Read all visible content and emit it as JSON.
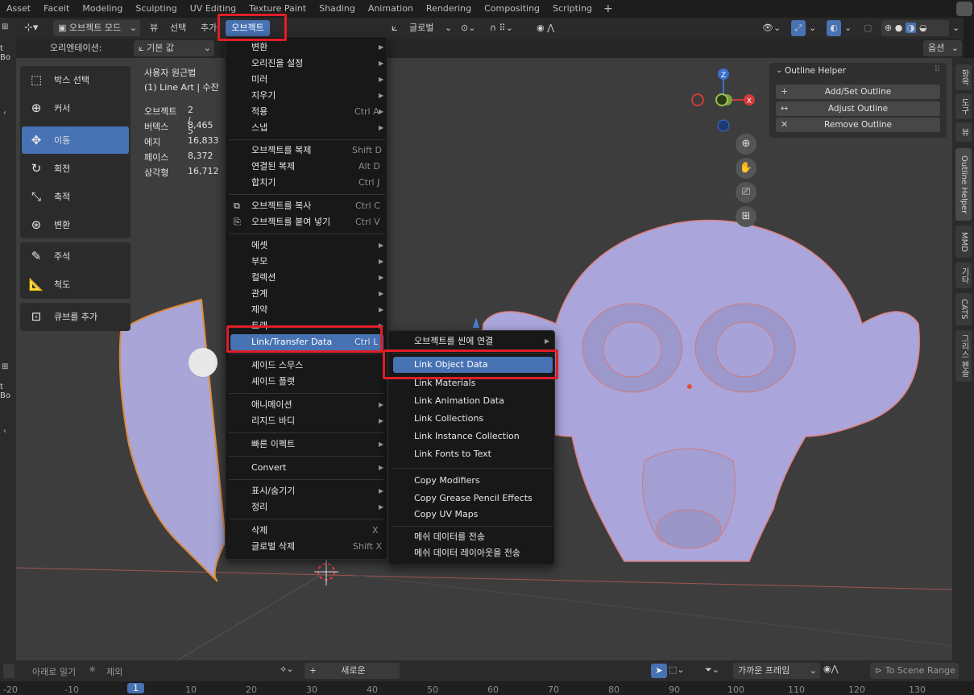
{
  "workspace_tabs": [
    "Asset",
    "Faceit",
    "Modeling",
    "Sculpting",
    "UV Editing",
    "Texture Paint",
    "Shading",
    "Animation",
    "Rendering",
    "Compositing",
    "Scripting"
  ],
  "header": {
    "mode": "오브젝트 모드",
    "menus": [
      "뷰",
      "선택",
      "추가",
      "오브젝트"
    ],
    "transform_orientation": "글로벌"
  },
  "subheader": {
    "orientation_label": "오리엔테이션:",
    "orientation_value": "기본 값",
    "options": "옵션"
  },
  "left_edge_labels": [
    "t Bo",
    "t Bo"
  ],
  "tools": [
    "박스 선택",
    "커서",
    "이동",
    "회전",
    "축적",
    "변환",
    "주석",
    "척도",
    "큐브를 추가"
  ],
  "viewport_info": {
    "view": "사용자 원근법",
    "object": "(1) Line Art | 수잔",
    "stats": [
      {
        "label": "오브젝트",
        "value": "2 / 5"
      },
      {
        "label": "버텍스",
        "value": "8,465"
      },
      {
        "label": "에지",
        "value": "16,833"
      },
      {
        "label": "페이스",
        "value": "8,372"
      },
      {
        "label": "삼각형",
        "value": "16,712"
      }
    ]
  },
  "gizmo": {
    "z": "Z",
    "x": "X"
  },
  "outline_panel": {
    "title": "Outline Helper",
    "buttons": [
      {
        "sym": "+",
        "label": "Add/Set Outline"
      },
      {
        "sym": "↔",
        "label": "Adjust Outline"
      },
      {
        "sym": "✕",
        "label": "Remove Outline"
      }
    ]
  },
  "right_tabs": [
    "항목",
    "도구",
    "뷰",
    "Outline Helper",
    "MMD",
    "기타",
    "CATS",
    "그리스 펜슬"
  ],
  "object_menu": {
    "items": [
      {
        "label": "변환",
        "shortcut": "",
        "submenu": true
      },
      {
        "label": "오리진을 설정",
        "shortcut": "",
        "submenu": true
      },
      {
        "label": "미러",
        "shortcut": "",
        "submenu": true
      },
      {
        "label": "지우기",
        "shortcut": "",
        "submenu": true
      },
      {
        "label": "적용",
        "shortcut": "Ctrl A",
        "submenu": true
      },
      {
        "label": "스냅",
        "shortcut": "",
        "submenu": true
      },
      {
        "label": "오브젝트를 복제",
        "shortcut": "Shift D",
        "submenu": false
      },
      {
        "label": "연결된 복제",
        "shortcut": "Alt D",
        "submenu": false
      },
      {
        "label": "합치기",
        "shortcut": "Ctrl J",
        "submenu": false
      },
      {
        "label": "오브젝트를 복사",
        "shortcut": "Ctrl C",
        "submenu": false
      },
      {
        "label": "오브젝트를 붙여 넣기",
        "shortcut": "Ctrl V",
        "submenu": false
      },
      {
        "label": "에셋",
        "shortcut": "",
        "submenu": true
      },
      {
        "label": "부모",
        "shortcut": "",
        "submenu": true
      },
      {
        "label": "컬렉션",
        "shortcut": "",
        "submenu": true
      },
      {
        "label": "관계",
        "shortcut": "",
        "submenu": true
      },
      {
        "label": "제약",
        "shortcut": "",
        "submenu": true
      },
      {
        "label": "트랙",
        "shortcut": "",
        "submenu": true
      },
      {
        "label": "Link/Transfer Data",
        "shortcut": "Ctrl L",
        "submenu": true
      },
      {
        "label": "셰이드 스무스",
        "shortcut": "",
        "submenu": false
      },
      {
        "label": "셰이드 플랫",
        "shortcut": "",
        "submenu": false
      },
      {
        "label": "애니메이션",
        "shortcut": "",
        "submenu": true
      },
      {
        "label": "리지드 바디",
        "shortcut": "",
        "submenu": true
      },
      {
        "label": "빠른 이펙트",
        "shortcut": "",
        "submenu": true
      },
      {
        "label": "Convert",
        "shortcut": "",
        "submenu": true
      },
      {
        "label": "표시/숨기기",
        "shortcut": "",
        "submenu": true
      },
      {
        "label": "정리",
        "shortcut": "",
        "submenu": true
      },
      {
        "label": "삭제",
        "shortcut": "X",
        "submenu": false
      },
      {
        "label": "글로벌 삭제",
        "shortcut": "Shift X",
        "submenu": false
      }
    ]
  },
  "link_submenu": {
    "items": [
      {
        "label": "오브젝트를 씬에 연결",
        "submenu": true
      },
      {
        "label": "Link Object Data",
        "submenu": false
      },
      {
        "label": "Link Materials",
        "submenu": false
      },
      {
        "label": "Link Animation Data",
        "submenu": false
      },
      {
        "label": "Link Collections",
        "submenu": false
      },
      {
        "label": "Link Instance Collection",
        "submenu": false
      },
      {
        "label": "Link Fonts to Text",
        "submenu": false
      },
      {
        "label": "Copy Modifiers",
        "submenu": false
      },
      {
        "label": "Copy Grease Pencil Effects",
        "submenu": false
      },
      {
        "label": "Copy UV Maps",
        "submenu": false
      },
      {
        "label": "메쉬 데이터를 전송",
        "submenu": false
      },
      {
        "label": "메쉬 데이터 레이아웃을 전송",
        "submenu": false
      }
    ]
  },
  "timeline": {
    "pull_down": "아래로 밀기",
    "exclude": "제외",
    "new": "새로운",
    "snap": "가까운 프레임",
    "scene_range": "To Scene Range",
    "current_frame": "1",
    "ticks": [
      "-20",
      "-10",
      "1",
      "10",
      "20",
      "30",
      "40",
      "50",
      "60",
      "70",
      "80",
      "90",
      "100",
      "110",
      "120",
      "130"
    ]
  },
  "colors": {
    "accent": "#4772b3",
    "highlight_box": "#e01e28",
    "viewport": "#3d3d3d",
    "mesh": "#a8a4d8"
  }
}
